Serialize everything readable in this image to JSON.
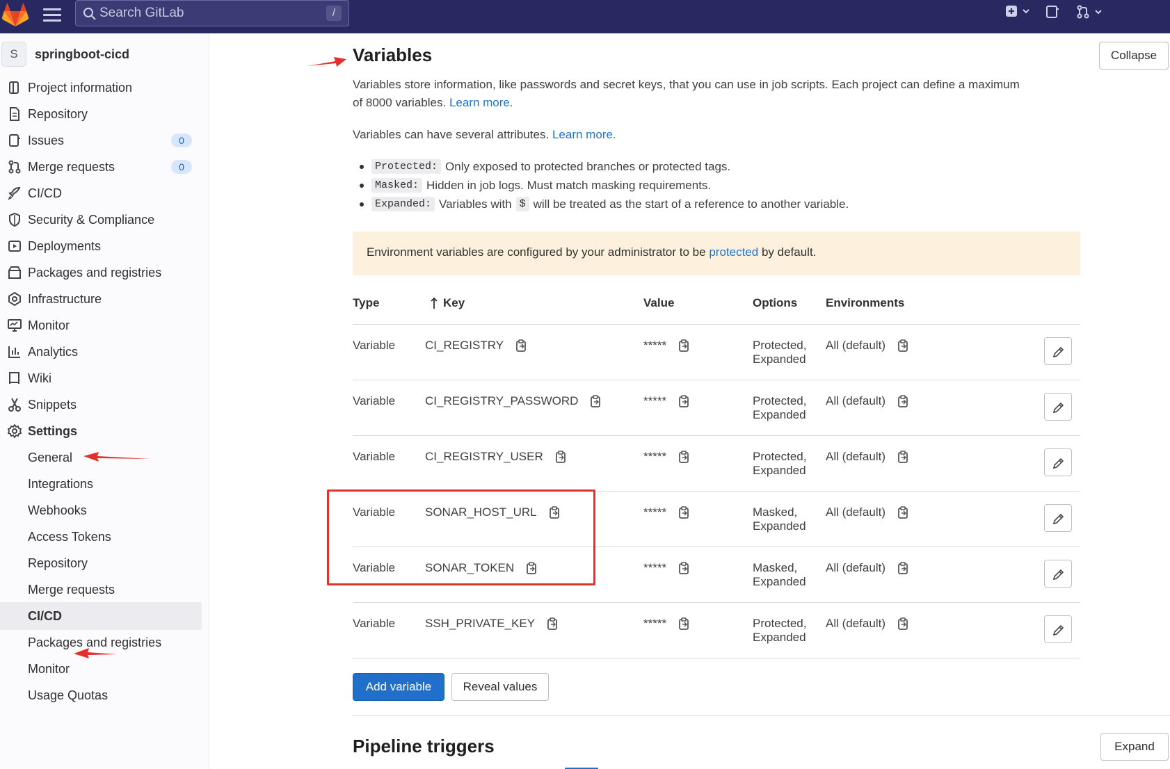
{
  "topbar": {
    "search_placeholder": "Search GitLab",
    "search_shortcut": "/",
    "colors": {
      "background": "#292961",
      "logo": "#e24329"
    }
  },
  "sidebar": {
    "project_avatar": "S",
    "project_name": "springboot-cicd",
    "items": [
      {
        "label": "Project information",
        "icon": "project-icon"
      },
      {
        "label": "Repository",
        "icon": "document-icon"
      },
      {
        "label": "Issues",
        "icon": "issues-icon",
        "badge": "0"
      },
      {
        "label": "Merge requests",
        "icon": "merge-request-icon",
        "badge": "0"
      },
      {
        "label": "CI/CD",
        "icon": "rocket-icon"
      },
      {
        "label": "Security & Compliance",
        "icon": "shield-icon"
      },
      {
        "label": "Deployments",
        "icon": "deployments-icon"
      },
      {
        "label": "Packages and registries",
        "icon": "package-icon"
      },
      {
        "label": "Infrastructure",
        "icon": "cloud-gear-icon"
      },
      {
        "label": "Monitor",
        "icon": "monitor-icon"
      },
      {
        "label": "Analytics",
        "icon": "chart-icon"
      },
      {
        "label": "Wiki",
        "icon": "book-icon"
      },
      {
        "label": "Snippets",
        "icon": "scissors-icon"
      },
      {
        "label": "Settings",
        "icon": "settings-icon"
      }
    ],
    "settings_sub": [
      "General",
      "Integrations",
      "Webhooks",
      "Access Tokens",
      "Repository",
      "Merge requests",
      "CI/CD",
      "Packages and registries",
      "Monitor",
      "Usage Quotas"
    ]
  },
  "main": {
    "title": "Variables",
    "collapse_label": "Collapse",
    "desc1": "Variables store information, like passwords and secret keys, that you can use in job scripts. Each project can define a maximum",
    "desc1b": "of 8000 variables.",
    "learn_more": "Learn more.",
    "desc2": "Variables can have several attributes.",
    "bullets": [
      {
        "code": "Protected:",
        "text": "Only exposed to protected branches or protected tags."
      },
      {
        "code": "Masked:",
        "text": "Hidden in job logs. Must match masking requirements."
      },
      {
        "code": "Expanded:",
        "text_before": "Variables with",
        "dollar": "$",
        "text_after": "will be treated as the start of a reference to another variable."
      }
    ],
    "alert": {
      "before": "Environment variables are configured by your administrator to be",
      "link": "protected",
      "after": "by default."
    },
    "table": {
      "headers": {
        "type": "Type",
        "key": "Key",
        "value": "Value",
        "options": "Options",
        "environments": "Environments"
      },
      "rows": [
        {
          "type": "Variable",
          "key": "CI_REGISTRY",
          "value": "*****",
          "options1": "Protected,",
          "options2": "Expanded",
          "env": "All (default)"
        },
        {
          "type": "Variable",
          "key": "CI_REGISTRY_PASSWORD",
          "value": "*****",
          "options1": "Protected,",
          "options2": "Expanded",
          "env": "All (default)"
        },
        {
          "type": "Variable",
          "key": "CI_REGISTRY_USER",
          "value": "*****",
          "options1": "Protected,",
          "options2": "Expanded",
          "env": "All (default)"
        },
        {
          "type": "Variable",
          "key": "SONAR_HOST_URL",
          "value": "*****",
          "options1": "Masked,",
          "options2": "Expanded",
          "env": "All (default)"
        },
        {
          "type": "Variable",
          "key": "SONAR_TOKEN",
          "value": "*****",
          "options1": "Masked,",
          "options2": "Expanded",
          "env": "All (default)"
        },
        {
          "type": "Variable",
          "key": "SSH_PRIVATE_KEY",
          "value": "*****",
          "options1": "Protected,",
          "options2": "Expanded",
          "env": "All (default)"
        }
      ]
    },
    "add_variable_label": "Add variable",
    "reveal_values_label": "Reveal values",
    "pipeline_triggers_title": "Pipeline triggers",
    "expand_label": "Expand",
    "annotation_color": "#e0312a"
  }
}
